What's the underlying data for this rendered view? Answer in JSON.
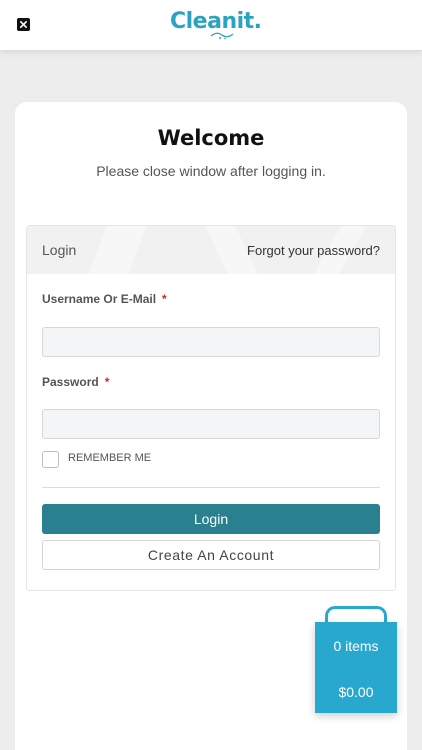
{
  "header": {
    "close_icon": "close-icon",
    "logo_text": "Cleanit."
  },
  "main": {
    "title": "Welcome",
    "subtitle": "Please close window after logging in."
  },
  "login_form": {
    "panel_title": "Login",
    "forgot_password": "Forgot your password?",
    "username_label": "Username Or E-Mail",
    "password_label": "Password",
    "required_mark": "*",
    "username_value": "",
    "password_value": "",
    "remember_label": "REMEMBER ME",
    "remember_checked": false,
    "login_button": "Login",
    "create_account_button": "Create An Account"
  },
  "cart": {
    "items": "0 items",
    "total": "$0.00"
  },
  "colors": {
    "brand": "#2aa3c2",
    "primary_button": "#29808f",
    "cart": "#29a8cf",
    "required": "#e02020"
  }
}
